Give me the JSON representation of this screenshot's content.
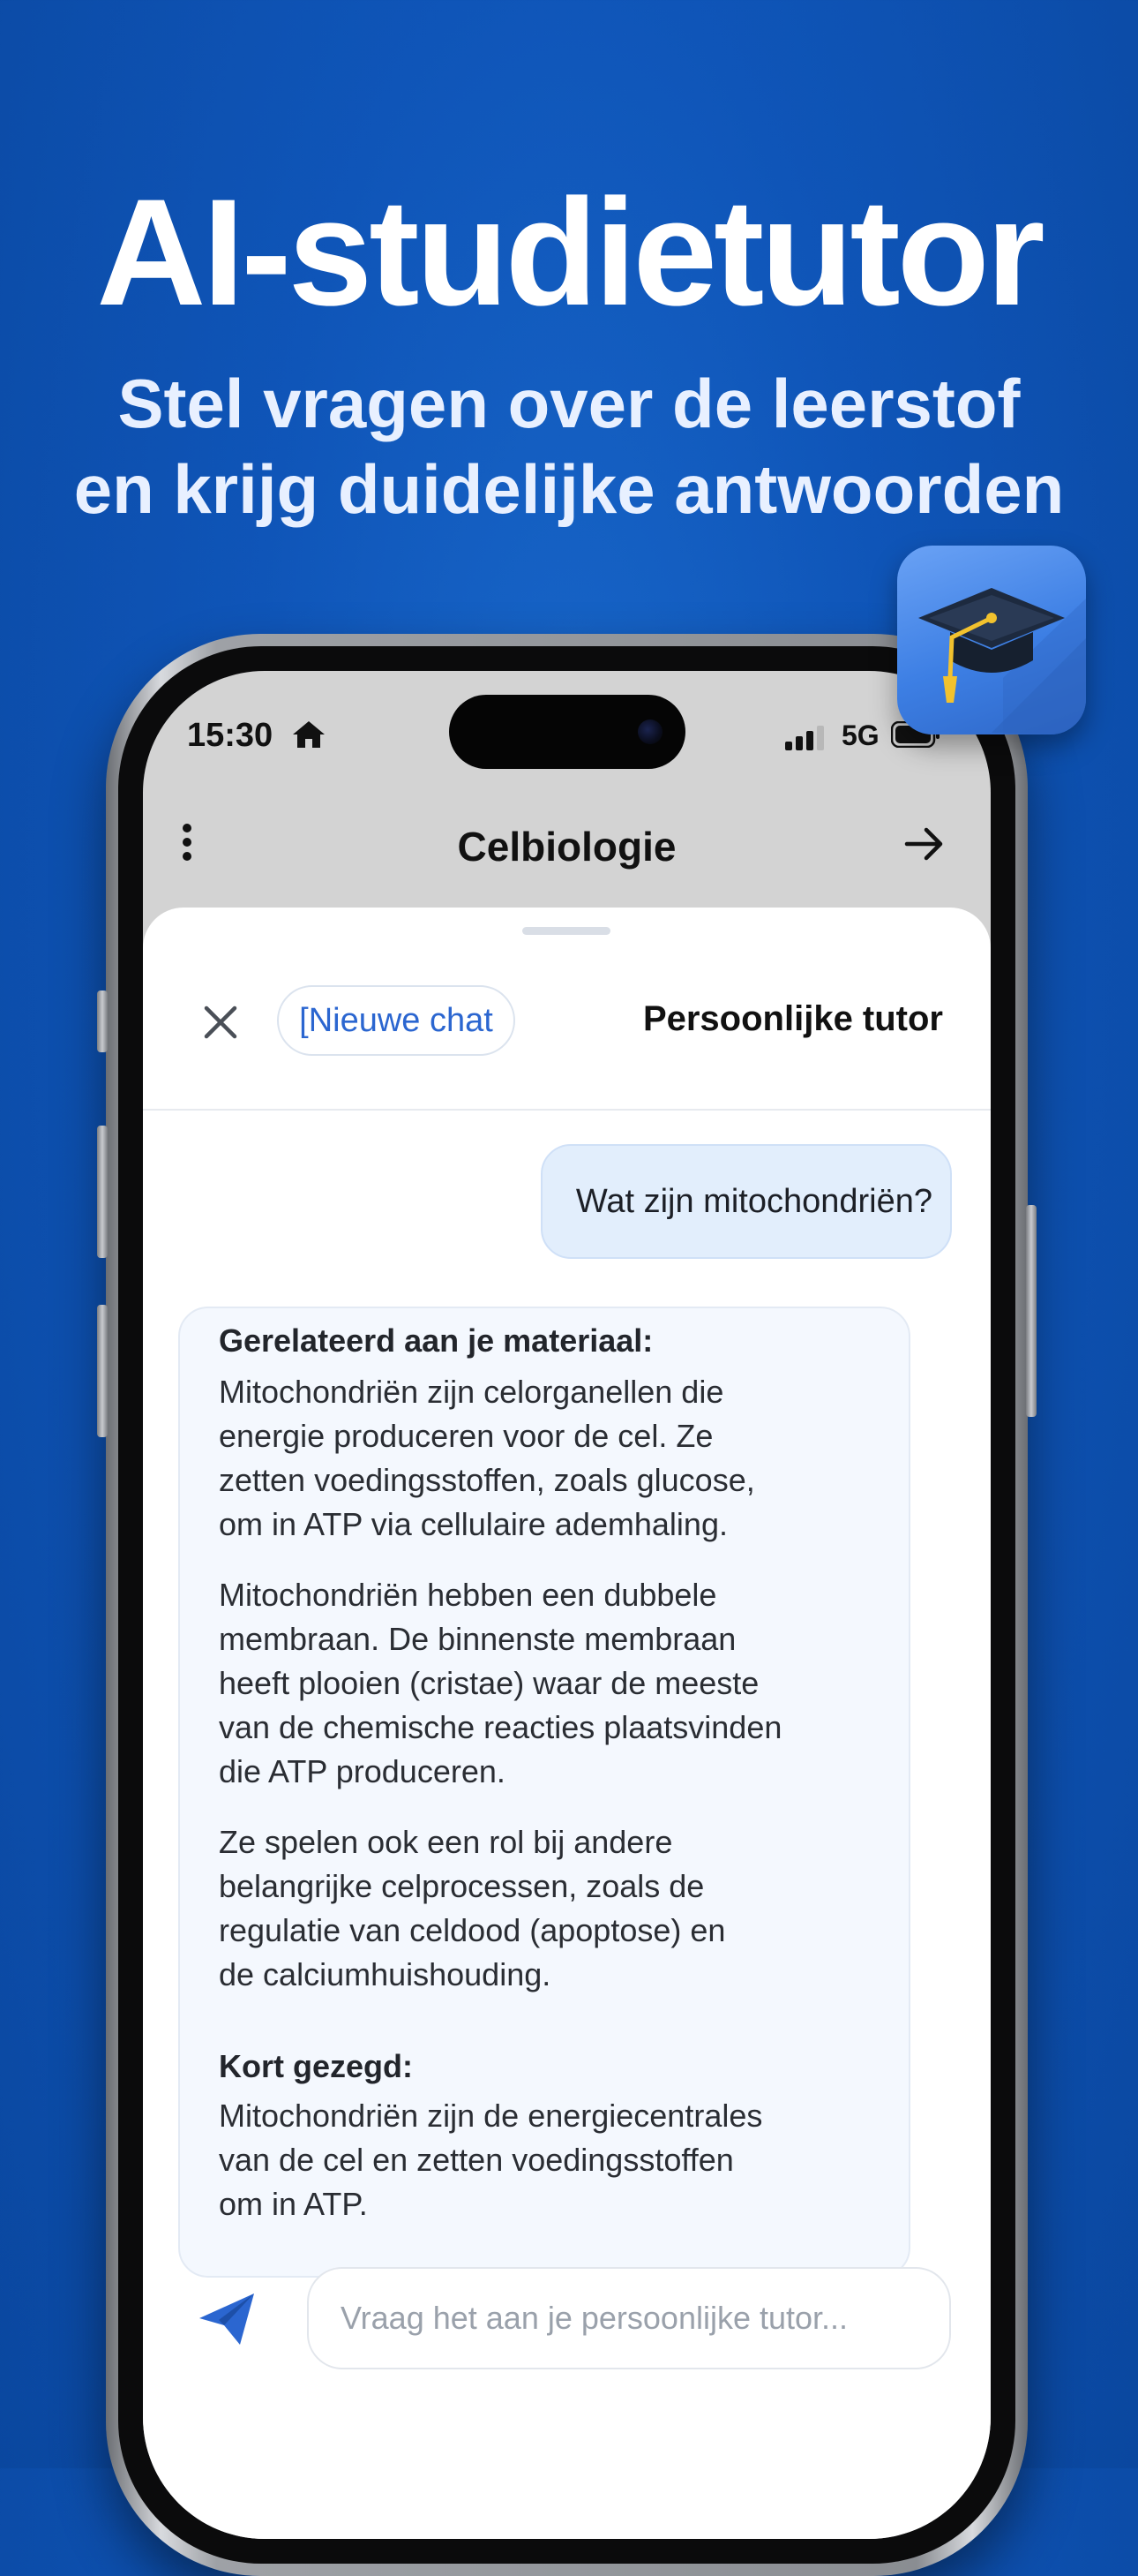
{
  "promo": {
    "headline": "AI-studietutor",
    "subline_1": "Stel vragen over de leerstof",
    "subline_2": "en krijg duidelijke antwoorden",
    "app_icon": "graduation-cap-icon"
  },
  "status_bar": {
    "time": "15:30",
    "network": "5G",
    "icons": [
      "home-icon",
      "signal-icon",
      "battery-icon"
    ]
  },
  "nav": {
    "title": "Celbiologie",
    "left_icon": "more-vertical-icon",
    "right_icon": "arrow-right-icon"
  },
  "sheet": {
    "new_chat_label": "[Nieuwe chat",
    "title": "Persoonlijke tutor",
    "close_icon": "close-icon"
  },
  "conversation": {
    "user_message": "Wat zijn mitochondriën?",
    "reply": {
      "heading": "Gerelateerd aan je materiaal:",
      "paragraph_1": [
        "Mitochondriën zijn celorganellen die",
        "energie produceren voor de cel. Ze",
        "zetten voedingsstoffen, zoals glucose,",
        "om in ATP via cellulaire ademhaling."
      ],
      "paragraph_2": [
        "Mitochondriën hebben een dubbele",
        "membraan. De binnenste membraan",
        "heeft plooien (cristae) waar de meeste",
        "van de chemische reacties plaatsvinden",
        "die ATP produceren."
      ],
      "paragraph_3": [
        "Ze spelen ook een rol bij andere",
        "belangrijke celprocessen, zoals de",
        "regulatie van celdood (apoptose) en",
        "de calciumhuishouding."
      ],
      "summary_heading": "Kort gezegd:",
      "summary": [
        "Mitochondriën zijn de energiecentrales",
        "van de cel en zetten voedingsstoffen",
        "om in ATP."
      ]
    }
  },
  "input": {
    "placeholder": "Vraag het aan je persoonlijke tutor...",
    "value": "",
    "send_icon": "send-icon"
  },
  "colors": {
    "background": "#0f55b8",
    "accent": "#2b66d0",
    "user_bubble": "#e2eefc",
    "reply_card": "#f4f8fe"
  }
}
